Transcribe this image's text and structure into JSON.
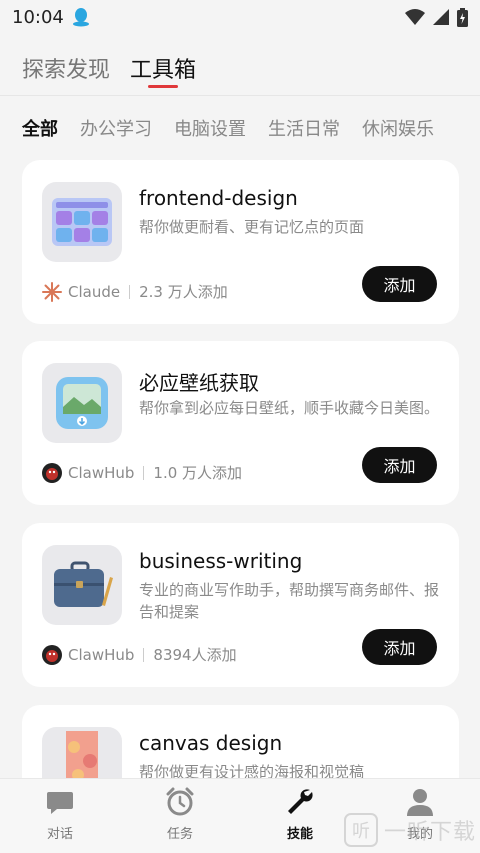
{
  "status": {
    "time": "10:04"
  },
  "top_tabs": [
    {
      "label": "探索发现",
      "active": false
    },
    {
      "label": "工具箱",
      "active": true
    }
  ],
  "categories": [
    "全部",
    "办公学习",
    "电脑设置",
    "生活日常",
    "休闲娱乐"
  ],
  "cards": [
    {
      "title": "frontend-design",
      "desc": "帮你做更耐看、更有记忆点的页面",
      "source": "Claude",
      "source_icon": "claude-icon",
      "count": "2.3 万人添加",
      "add_label": "添加"
    },
    {
      "title": "必应壁纸获取",
      "desc": "帮你拿到必应每日壁纸，顺手收藏今日美图。",
      "source": "ClawHub",
      "source_icon": "clawhub-icon",
      "count": "1.0 万人添加",
      "add_label": "添加"
    },
    {
      "title": "business-writing",
      "desc": "专业的商业写作助手，帮助撰写商务邮件、报告和提案",
      "source": "ClawHub",
      "source_icon": "clawhub-icon",
      "count": "8394人添加",
      "add_label": "添加"
    },
    {
      "title": "canvas design",
      "desc": "帮你做更有设计感的海报和视觉稿"
    }
  ],
  "bottom_nav": [
    {
      "label": "对话",
      "icon": "chat-icon",
      "active": false
    },
    {
      "label": "任务",
      "icon": "alarm-clock-icon",
      "active": false
    },
    {
      "label": "技能",
      "icon": "wrench-icon",
      "active": true
    },
    {
      "label": "我的",
      "icon": "person-icon",
      "active": false
    }
  ],
  "watermark": {
    "text": "一听下载"
  },
  "colors": {
    "accent": "#e0383a",
    "button": "#111111",
    "claude": "#d97757",
    "clawhub": "#c0312b"
  }
}
